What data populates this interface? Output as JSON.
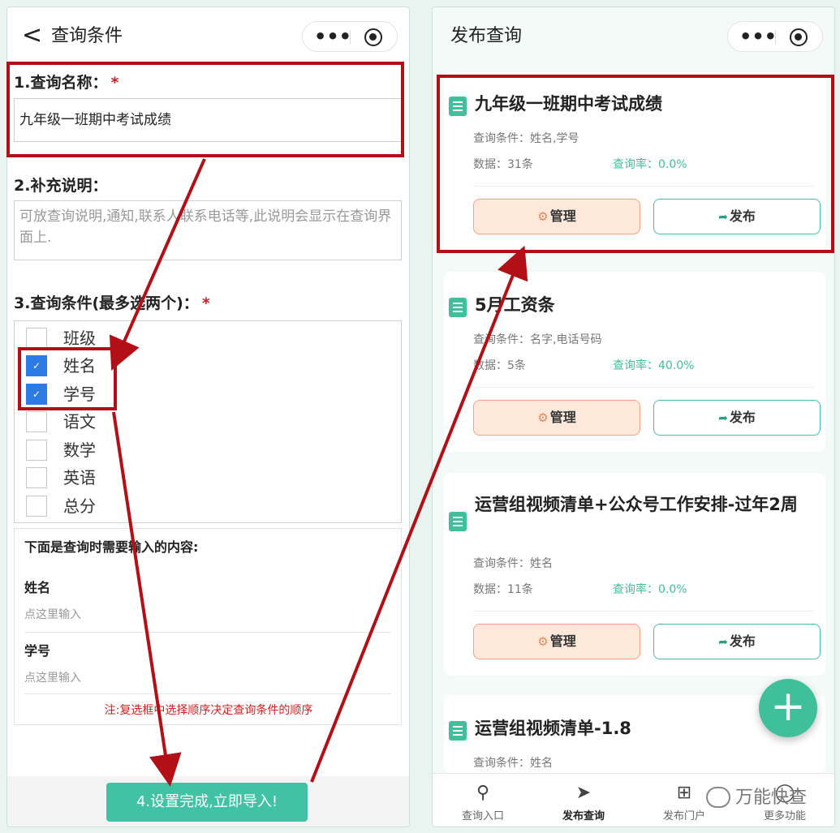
{
  "left_screen": {
    "title": "查询条件",
    "name_label": "1.查询名称：",
    "required_mark": "*",
    "name_value": "九年级一班期中考试成绩",
    "desc_label": "2.补充说明：",
    "desc_placeholder": "可放查询说明,通知,联系人联系电话等,此说明会显示在查询界面上.",
    "conditions_label": "3.查询条件(最多选两个)：",
    "conditions": [
      {
        "label": "班级",
        "checked": false
      },
      {
        "label": "姓名",
        "checked": true
      },
      {
        "label": "学号",
        "checked": true
      },
      {
        "label": "语文",
        "checked": false
      },
      {
        "label": "数学",
        "checked": false
      },
      {
        "label": "英语",
        "checked": false
      },
      {
        "label": "总分",
        "checked": false
      }
    ],
    "check_mark": "✓",
    "inputs_title": "下面是查询时需要输入的内容:",
    "inputs": [
      {
        "name": "姓名",
        "placeholder": "点这里输入"
      },
      {
        "name": "学号",
        "placeholder": "点这里输入"
      }
    ],
    "note": "注:复选框中选择顺序决定查询条件的顺序",
    "submit_label": "4.设置完成,立即导入!"
  },
  "right_screen": {
    "title": "发布查询",
    "cards": [
      {
        "title": "九年级一班期中考试成绩",
        "conditions": "查询条件：姓名,学号",
        "data": "数据：31条",
        "rate": "查询率：0.0%",
        "manage": "管理",
        "publish": "发布"
      },
      {
        "title": "5月工资条",
        "conditions": "查询条件：名字,电话号码",
        "data": "数据：5条",
        "rate": "查询率：40.0%",
        "manage": "管理",
        "publish": "发布"
      },
      {
        "title": "运营组视频清单+公众号工作安排-过年2周",
        "conditions": "查询条件：姓名",
        "data": "数据：11条",
        "rate": "查询率：0.0%",
        "manage": "管理",
        "publish": "发布"
      },
      {
        "title": "运营组视频清单-1.8",
        "conditions": "查询条件：姓名"
      }
    ],
    "tabs": [
      {
        "label": "查询入口",
        "icon": "search-icon"
      },
      {
        "label": "发布查询",
        "icon": "paper-plane-icon",
        "active": true
      },
      {
        "label": "发布门户",
        "icon": "sitemap-icon"
      },
      {
        "label": "更多功能",
        "icon": "more-icon"
      }
    ]
  },
  "watermark": "万能快查",
  "colors": {
    "accent": "#42c2a4",
    "annotation": "#b20f16",
    "manage_bg": "#fde8da",
    "required": "#d21f1f"
  }
}
